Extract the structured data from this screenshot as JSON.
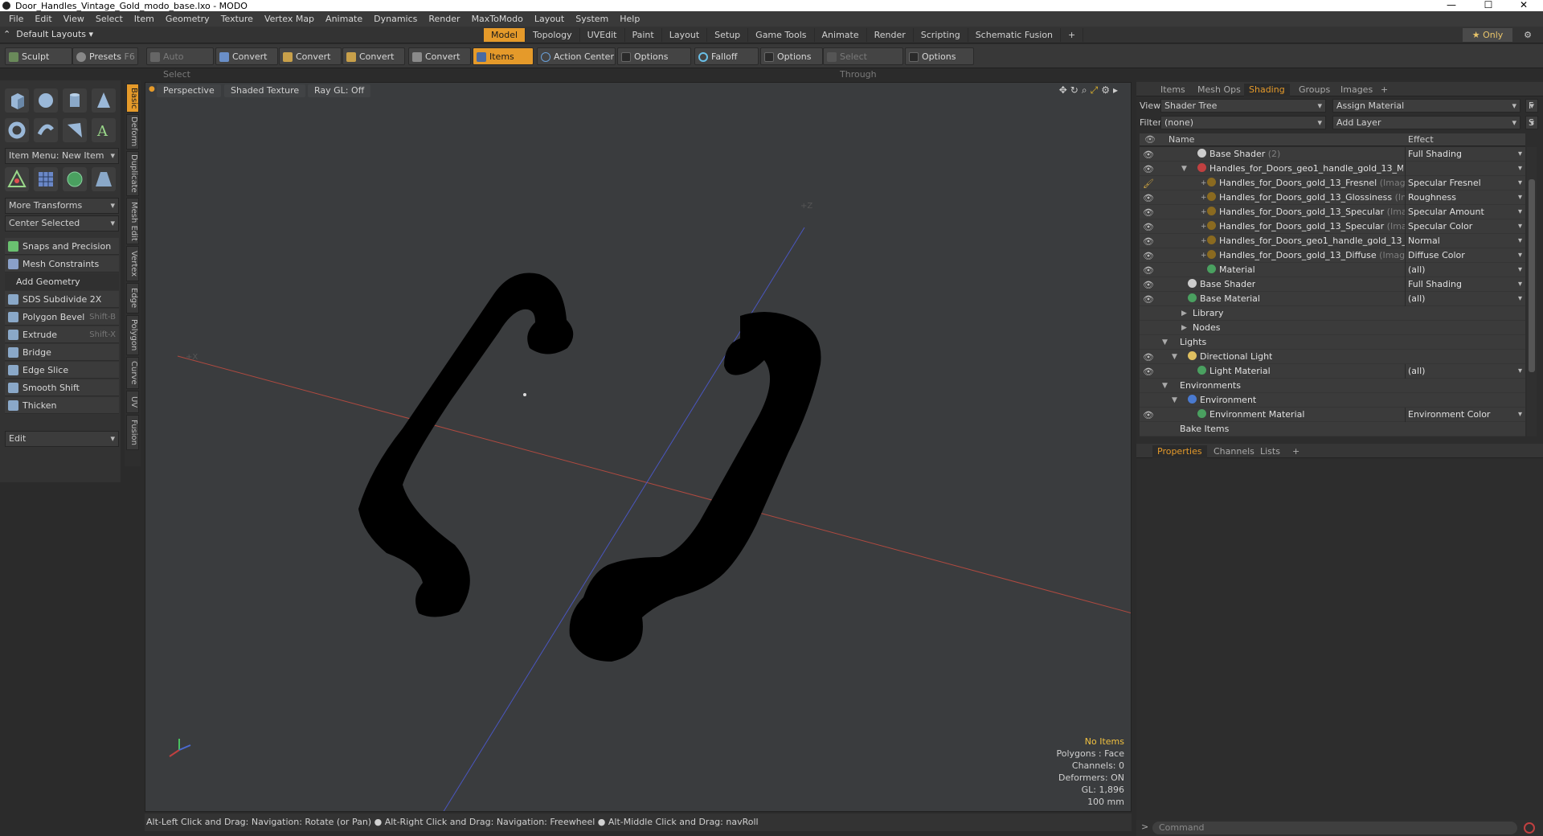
{
  "window": {
    "title": "Door_Handles_Vintage_Gold_modo_base.lxo - MODO",
    "min": "—",
    "max": "☐",
    "close": "✕"
  },
  "menu": [
    "File",
    "Edit",
    "View",
    "Select",
    "Item",
    "Geometry",
    "Texture",
    "Vertex Map",
    "Animate",
    "Dynamics",
    "Render",
    "MaxToModo",
    "Layout",
    "System",
    "Help"
  ],
  "layout": {
    "label": "Default Layouts ▾"
  },
  "tabs": [
    "Model",
    "Topology",
    "UVEdit",
    "Paint",
    "Layout",
    "Setup",
    "Game Tools",
    "Animate",
    "Render",
    "Scripting",
    "Schematic Fusion",
    "+"
  ],
  "only": "★  Only",
  "toolbar": {
    "sculpt": "Sculpt",
    "presets": "Presets",
    "presets_key": "F6",
    "auto_select": "Auto Select",
    "convert": "Convert",
    "items": "Items",
    "action_center": "Action Center",
    "options": "Options",
    "falloff": "Falloff",
    "select_through": "Select Through"
  },
  "left": {
    "item_menu": "Item Menu: New Item",
    "more_transforms": "More Transforms",
    "center_selected": "Center Selected",
    "snaps": "Snaps and Precision",
    "mesh_constraints": "Mesh Constraints",
    "add_geometry": "Add Geometry",
    "tools": [
      {
        "label": "SDS Subdivide 2X",
        "key": ""
      },
      {
        "label": "Polygon Bevel",
        "key": "Shift-B"
      },
      {
        "label": "Extrude",
        "key": "Shift-X"
      },
      {
        "label": "Bridge",
        "key": ""
      },
      {
        "label": "Edge Slice",
        "key": ""
      },
      {
        "label": "Smooth Shift",
        "key": ""
      },
      {
        "label": "Thicken",
        "key": ""
      }
    ],
    "edit": "Edit",
    "vtabs": [
      "Basic",
      "Deform",
      "Duplicate",
      "Mesh Edit",
      "Vertex",
      "Edge",
      "Polygon",
      "Curve",
      "UV",
      "Fusion"
    ]
  },
  "viewport": {
    "perspective": "Perspective",
    "shaded": "Shaded Texture",
    "raygl": "Ray GL: Off",
    "info": {
      "no_items": "No Items",
      "polygons": "Polygons : Face",
      "channels": "Channels: 0",
      "deformers": "Deformers: ON",
      "gl": "GL: 1,896",
      "scale": "100 mm"
    },
    "axis_x": "+X",
    "axis_z": "+Z"
  },
  "status": "Alt-Left Click and Drag: Navigation: Rotate (or Pan) ● Alt-Right Click and Drag: Navigation: Freewheel ● Alt-Middle Click and Drag: navRoll",
  "right": {
    "tabs": [
      "Items",
      "Mesh Ops",
      "Shading",
      "Groups",
      "Images",
      "+"
    ],
    "view_label": "View",
    "view_value": "Shader Tree",
    "assign": "Assign Material",
    "f": "F",
    "filter_label": "Filter",
    "filter_value": "(none)",
    "add_layer": "Add Layer",
    "s": "S",
    "col_name": "Name",
    "col_effect": "Effect",
    "rows": [
      {
        "name": "Base Shader",
        "tag": "(2)",
        "effect": "Full Shading"
      },
      {
        "name": "Handles_for_Doors_geo1_handle_gold_13_M ...",
        "tag": "",
        "effect": ""
      },
      {
        "name": "Handles_for_Doors_gold_13_Fresnel",
        "tag": "(Image)",
        "effect": "Specular Fresnel"
      },
      {
        "name": "Handles_for_Doors_gold_13_Glossiness",
        "tag": "(Im ...",
        "effect": "Roughness"
      },
      {
        "name": "Handles_for_Doors_gold_13_Specular",
        "tag": "(Ima ...",
        "effect": "Specular Amount"
      },
      {
        "name": "Handles_for_Doors_gold_13_Specular",
        "tag": "(Image)",
        "effect": "Specular Color"
      },
      {
        "name": "Handles_for_Doors_geo1_handle_gold_13_...",
        "tag": "",
        "effect": "Normal"
      },
      {
        "name": "Handles_for_Doors_gold_13_Diffuse",
        "tag": "(Image)",
        "effect": "Diffuse Color"
      },
      {
        "name": "Material",
        "tag": "",
        "effect": "(all)"
      },
      {
        "name": "Base Shader",
        "tag": "",
        "effect": "Full Shading"
      },
      {
        "name": "Base Material",
        "tag": "",
        "effect": "(all)"
      },
      {
        "name": "Library",
        "tag": "",
        "effect": ""
      },
      {
        "name": "Nodes",
        "tag": "",
        "effect": ""
      },
      {
        "name": "Lights",
        "tag": "",
        "effect": ""
      },
      {
        "name": "Directional Light",
        "tag": "",
        "effect": ""
      },
      {
        "name": "Light Material",
        "tag": "",
        "effect": "(all)"
      },
      {
        "name": "Environments",
        "tag": "",
        "effect": ""
      },
      {
        "name": "Environment",
        "tag": "",
        "effect": ""
      },
      {
        "name": "Environment Material",
        "tag": "",
        "effect": "Environment Color"
      },
      {
        "name": "Bake Items",
        "tag": "",
        "effect": ""
      }
    ],
    "prop_tabs": [
      "Properties",
      "Channels",
      "Lists",
      "+"
    ],
    "command_placeholder": "Command"
  },
  "colors": {
    "accent": "#e59a2a",
    "x_axis": "#c0453a",
    "z_axis": "#4a5ad0"
  }
}
